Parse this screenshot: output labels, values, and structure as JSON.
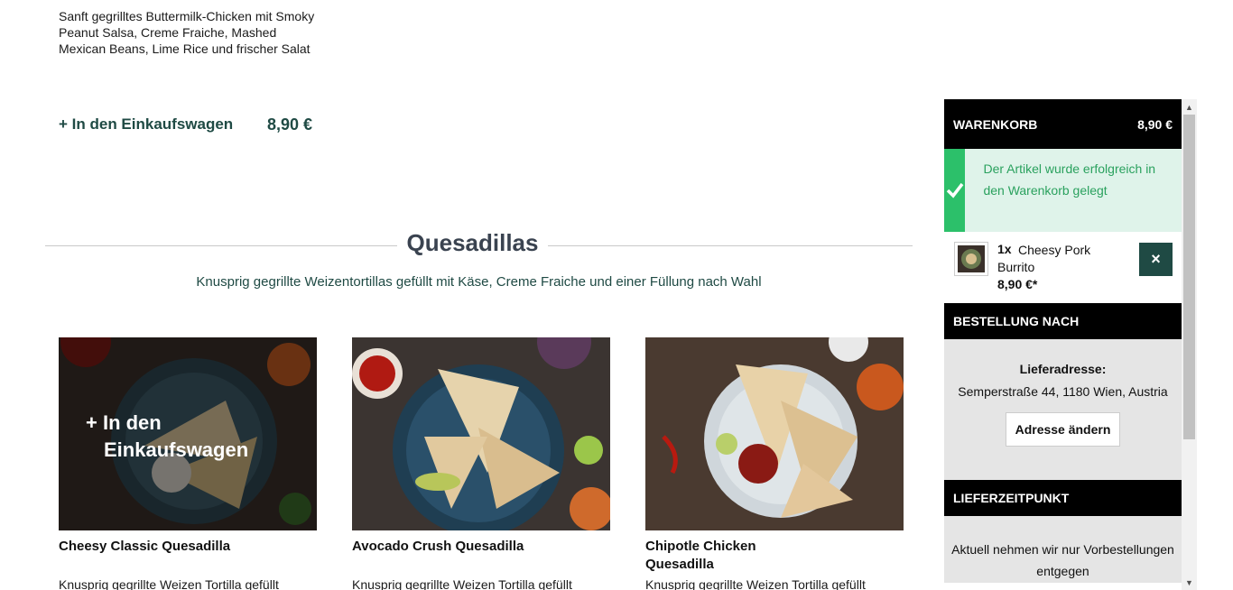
{
  "top_product": {
    "description": "Sanft gegrilltes Buttermilk-Chicken mit Smoky Peanut Salsa, Creme Fraiche, Mashed Mexican Beans, Lime Rice und frischer Salat",
    "add_label": "+ In den Einkaufswagen",
    "price": "8,90 €"
  },
  "section": {
    "title": "Quesadillas",
    "subtitle": "Knusprig gegrillte Weizentortillas gefüllt mit Käse, Creme Fraiche und einer Füllung nach Wahl"
  },
  "products": [
    {
      "title": "Cheesy Classic Quesadilla",
      "desc": "Knusprig gegrillte Weizen Tortilla gefüllt",
      "overlay_line1": "+ In den",
      "overlay_line2": "Einkaufswagen"
    },
    {
      "title": "Avocado Crush Quesadilla",
      "desc": "Knusprig gegrillte Weizen Tortilla gefüllt"
    },
    {
      "title": "Chipotle Chicken Quesadilla",
      "desc": "Knusprig gegrillte Weizen Tortilla gefüllt"
    }
  ],
  "cart": {
    "title": "WARENKORB",
    "total": "8,90 €",
    "success_msg": "Der Artikel wurde erfolgreich in den Warenkorb gelegt",
    "item": {
      "qty": "1x",
      "name": "Cheesy Pork Burrito",
      "price": "8,90 €*",
      "remove": "×"
    },
    "order_section": "BESTELLUNG NACH",
    "address_label": "Lieferadresse:",
    "address": "Semperstraße 44, 1180 Wien, Austria",
    "change_address": "Adresse ändern",
    "time_section": "LIEFERZEITPUNKT",
    "time_msg": "Aktuell nehmen wir nur Vorbestellungen entgegen"
  },
  "colors": {
    "brand_green": "#1f4a44",
    "success_green": "#2cc06a",
    "success_bg": "#dff3ea"
  }
}
